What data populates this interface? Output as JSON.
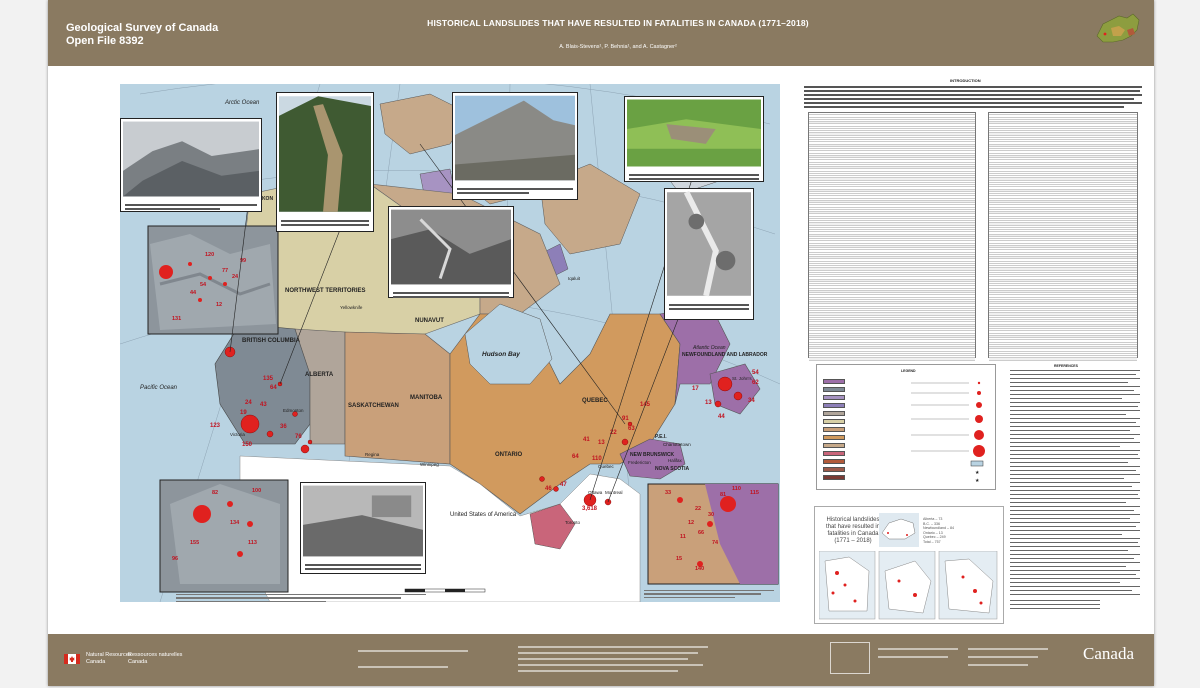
{
  "header": {
    "agency": "Geological Survey of Canada",
    "open_file": "Open File 8392",
    "title": "HISTORICAL LANDSLIDES THAT HAVE RESULTED IN FATALITIES IN CANADA (1771–2018)",
    "authors": "A. Blais-Stevens¹, P. Behnia¹, and A. Castagner²"
  },
  "map": {
    "ocean_labels": [
      "Arctic Ocean",
      "Pacific Ocean",
      "Atlantic Ocean",
      "Hudson Bay"
    ],
    "region_labels": [
      "YUKON",
      "NORTHWEST TERRITORIES",
      "NUNAVUT",
      "BRITISH COLUMBIA",
      "ALBERTA",
      "SASKATCHEWAN",
      "MANITOBA",
      "ONTARIO",
      "QUEBEC",
      "NEWFOUNDLAND AND LABRADOR",
      "NEW BRUNSWICK",
      "NOVA SCOTIA",
      "P.E.I.",
      "United States of America"
    ],
    "city_labels": [
      "Yellowknife",
      "Edmonton",
      "Regina",
      "Winnipeg",
      "Toronto",
      "Ottawa",
      "Montreal",
      "Quebec",
      "Fredericton",
      "Halifax",
      "Charlottetown",
      "St. John's",
      "Victoria",
      "Iqaluit",
      "Whitehorse"
    ],
    "fatality_labels": [
      "150",
      "3,618",
      "123",
      "41",
      "64",
      "110",
      "13",
      "46",
      "47",
      "145",
      "44",
      "17",
      "34",
      "13",
      "54",
      "62",
      "91",
      "63",
      "22",
      "24",
      "43",
      "19",
      "64",
      "135",
      "36",
      "76"
    ],
    "west_inset_labels": [
      "120",
      "54",
      "131",
      "44",
      "77",
      "12",
      "99",
      "24"
    ],
    "sw_inset_labels": [
      "100",
      "134",
      "82",
      "155",
      "113",
      "96"
    ],
    "se_inset_labels": [
      "110",
      "81",
      "33",
      "115",
      "12",
      "140",
      "74",
      "22",
      "30",
      "66",
      "11",
      "15"
    ]
  },
  "right_panel": {
    "intro_heading": "INTRODUCTION",
    "legend_heading": "LEGEND",
    "references_heading": "REFERENCES",
    "inset_title": "Historical landslides that have resulted in fatalities in Canada (1771 – 2018)",
    "inset_stats": [
      "Alberta – 73",
      "B.C. – 336",
      "Newfoundland – 84",
      "Ontario – 13",
      "Quebec – 249",
      "Total – 757"
    ]
  },
  "footer": {
    "dept_en": [
      "Natural Resources",
      "Canada"
    ],
    "dept_fr": [
      "Ressources naturelles",
      "Canada"
    ],
    "wordmark": "Canada"
  },
  "colors": {
    "header_brown": "#8a7a61",
    "water": "#b9d3e2",
    "yukon_nwt": "#d8d0a6",
    "nunavut": "#c6a98a",
    "bc": "#7f8a94",
    "alberta": "#b0a59a",
    "prairies": "#c9a07a",
    "ontario_quebec": "#d19a5e",
    "atlantic": "#9d6fa8",
    "fatality_marker": "#e0211f"
  }
}
